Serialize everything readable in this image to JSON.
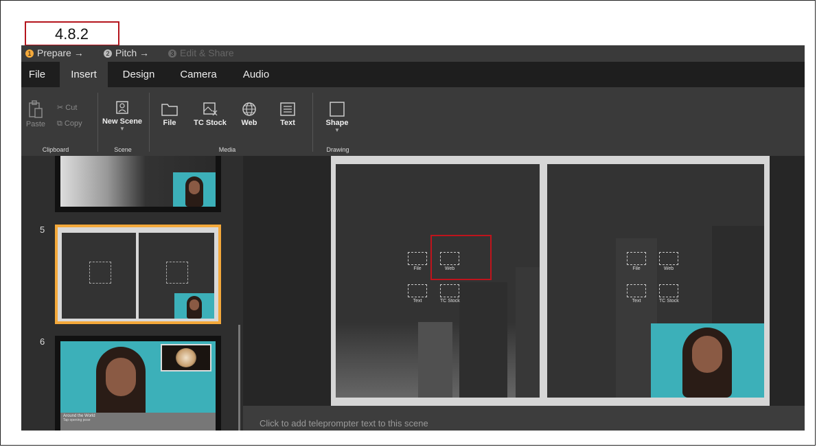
{
  "version_label": "4.8.2",
  "steps": [
    {
      "num": "1",
      "label": "Prepare",
      "arrow": "→",
      "state": "active"
    },
    {
      "num": "2",
      "label": "Pitch",
      "arrow": "→",
      "state": "normal"
    },
    {
      "num": "3",
      "label": "Edit & Share",
      "arrow": "",
      "state": "disabled"
    }
  ],
  "menu": {
    "file": "File",
    "insert": "Insert",
    "design": "Design",
    "camera": "Camera",
    "audio": "Audio"
  },
  "ribbon": {
    "paste": "Paste",
    "cut": "Cut",
    "copy": "Copy",
    "clipboard_group": "Clipboard",
    "new_scene": "New Scene",
    "scene_group": "Scene",
    "file": "File",
    "tc_stock": "TC Stock",
    "web": "Web",
    "text": "Text",
    "media_group": "Media",
    "shape": "Shape",
    "drawing_group": "Drawing"
  },
  "scenes": [
    {
      "number": "5"
    },
    {
      "number": "6",
      "caption_title": "Around the World",
      "caption_sub": "Tap opening pose"
    }
  ],
  "placeholders": {
    "file": "File",
    "web": "Web",
    "text": "Text",
    "tc_stock": "TC Stock"
  },
  "teleprompter_placeholder": "Click to add teleprompter text to this scene",
  "colors": {
    "accent": "#f4a93b",
    "highlight": "#c0141c",
    "backdrop": "#3cb0b9"
  }
}
